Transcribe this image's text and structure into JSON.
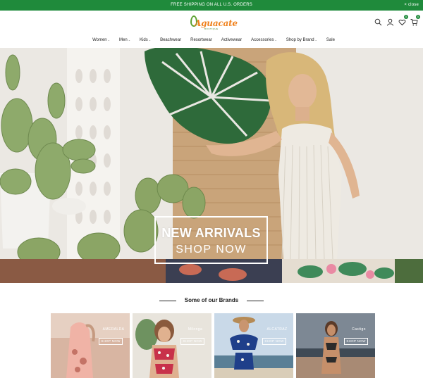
{
  "promo": {
    "message": "FREE SHIPPING ON ALL U.S. ORDERS",
    "close_label": "close"
  },
  "header": {
    "logo": {
      "word": "Aguacate",
      "sub": "BOUTIQUE"
    },
    "wishlist_count": "0",
    "cart_count": "0"
  },
  "nav": {
    "items": [
      {
        "label": "Women",
        "has_caret": true
      },
      {
        "label": "Men",
        "has_caret": true
      },
      {
        "label": "Kids",
        "has_caret": true
      },
      {
        "label": "Beachwear",
        "has_caret": false
      },
      {
        "label": "Resortwear",
        "has_caret": false
      },
      {
        "label": "Activewear",
        "has_caret": false
      },
      {
        "label": "Accessories",
        "has_caret": true
      },
      {
        "label": "Shop by Brand",
        "has_caret": true
      },
      {
        "label": "Sale",
        "has_caret": false
      }
    ]
  },
  "hero": {
    "title": "NEW ARRIVALS",
    "cta": "SHOP NOW"
  },
  "brands": {
    "title": "Some of our Brands",
    "items": [
      {
        "name": "AMERALDA",
        "cta": "SHOP NOW"
      },
      {
        "name": "Milonga",
        "cta": "SHOP NOW"
      },
      {
        "name": "ALCATRAZ",
        "cta": "SHOP NOW"
      },
      {
        "name": "Castigo",
        "cta": "SHOP NOW"
      }
    ]
  },
  "colors": {
    "brand_green": "#1f8a3b",
    "logo_orange": "#f0821e"
  }
}
